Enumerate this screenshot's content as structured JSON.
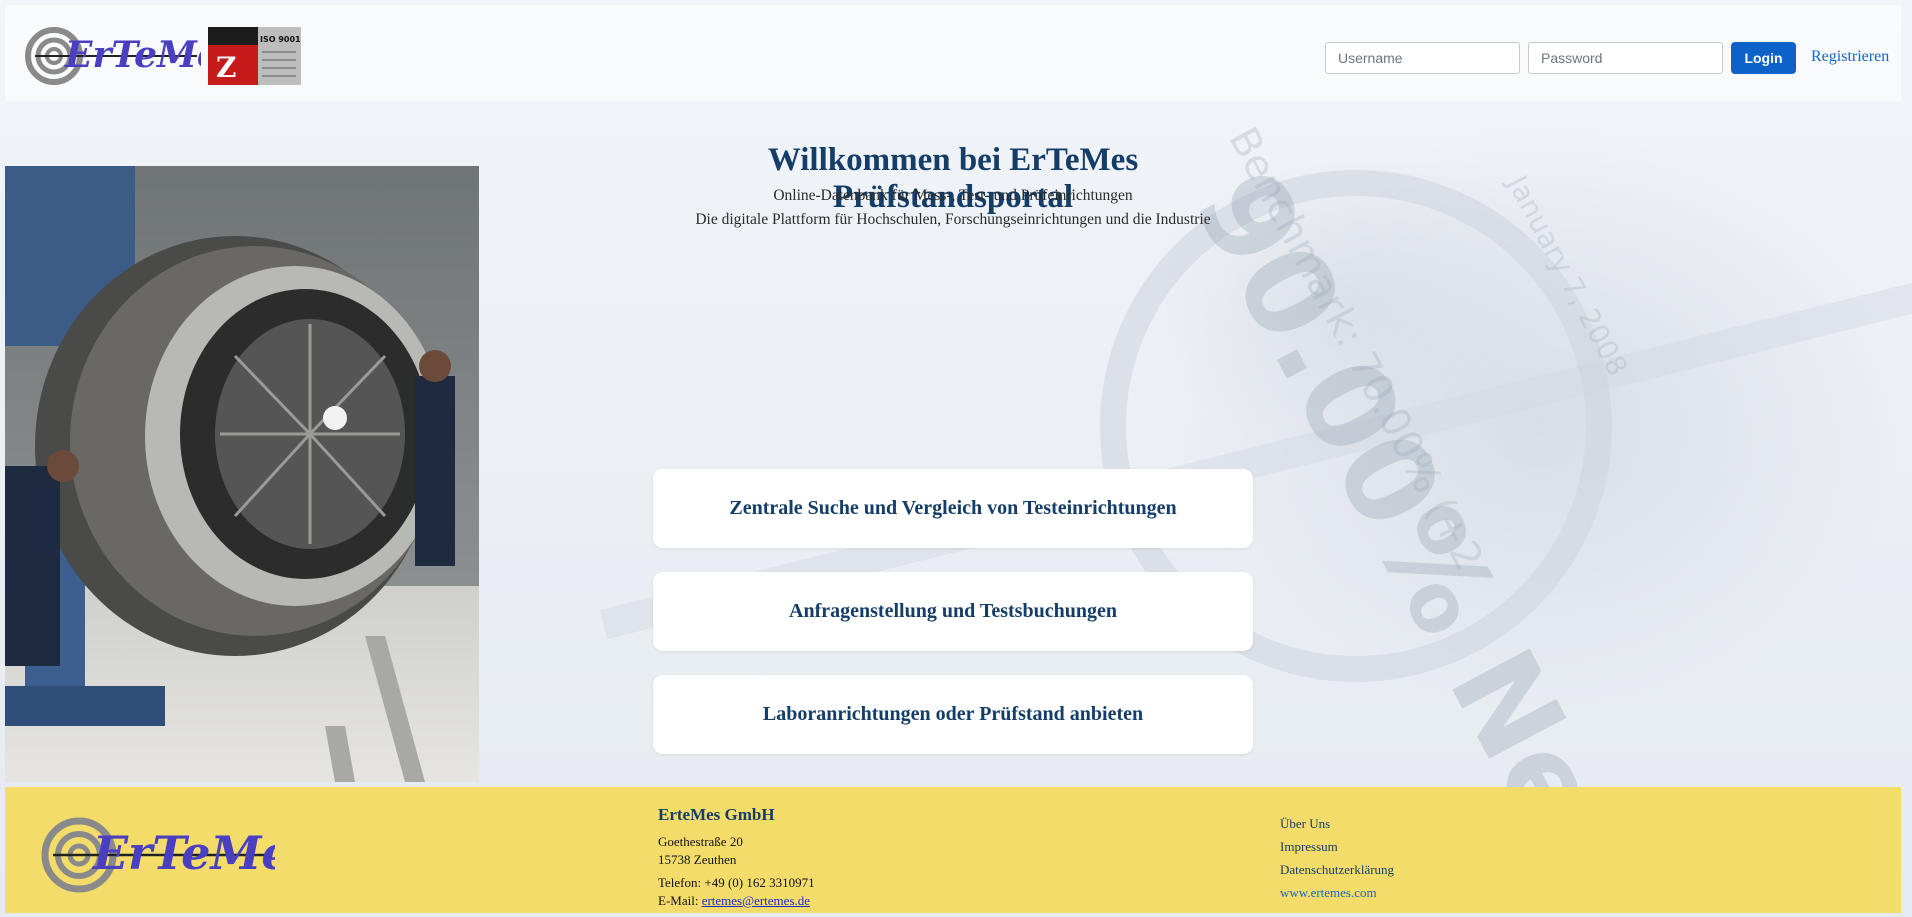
{
  "header": {
    "username_placeholder": "Username",
    "password_placeholder": "Password",
    "login_label": "Login",
    "register_label": "Registrieren"
  },
  "hero": {
    "title": "Willkommen bei ErTeMes Prüfstandsportal",
    "subtitle_1": "Online-Datenbank für Mess-, Test- und Prüfeinrichtungen",
    "subtitle_2": "Die digitale Plattform für Hochschulen, Forschungseinrichtungen und die Industrie"
  },
  "cards": [
    {
      "label": "Zentrale Suche und Vergleich von Testeinrichtungen"
    },
    {
      "label": "Anfragenstellung und Testsbuchungen"
    },
    {
      "label": "Laboranrichtungen oder Prüfstand anbieten"
    }
  ],
  "footer": {
    "company": "ErteMes GmbH",
    "street": "Goethestraße 20",
    "city": "15738 Zeuthen",
    "phone": "Telefon: +49 (0) 162 3310971",
    "email_prefix": "E-Mail: ",
    "email": "ertemes@ertemes.de",
    "links": {
      "about": "Über Uns",
      "imprint": "Impressum",
      "privacy": "Datenschutzerklärung",
      "website": "www.ertemes.com"
    }
  },
  "background": {
    "text_large": "90.00% Ne",
    "text_benchmark": "Benchmark: 70.00% (+2",
    "text_date": "January 7, 2008"
  },
  "colors": {
    "brand_navy": "#143d67",
    "login_blue": "#0d62c9",
    "footer_yellow": "#f4dc6b",
    "logo_purple": "#4a3fc1"
  },
  "cert": {
    "iso": "ISO 9001",
    "letter": "Z"
  }
}
